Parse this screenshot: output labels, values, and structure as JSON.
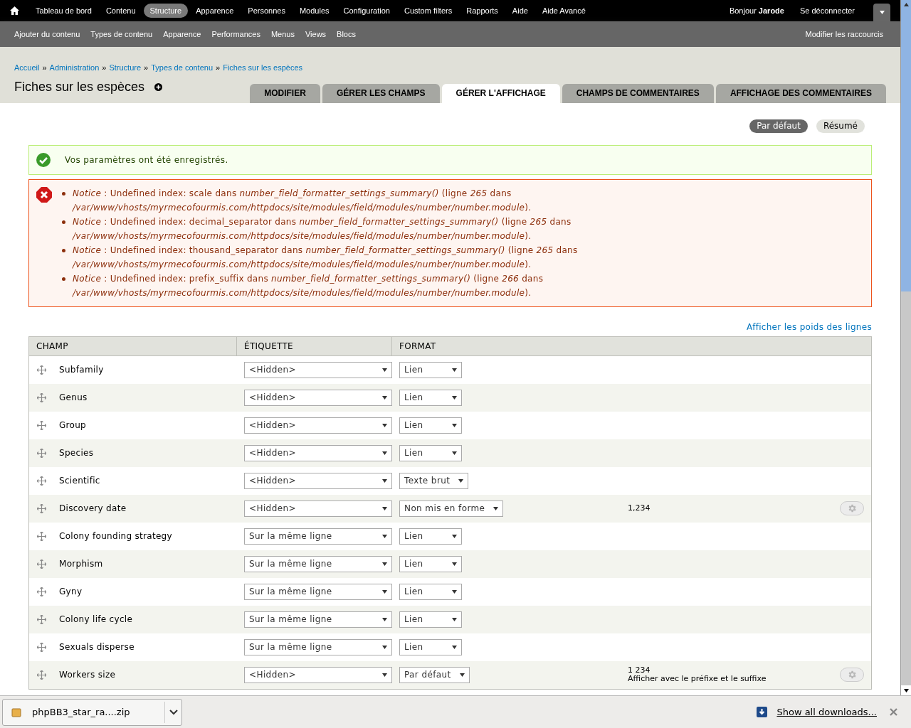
{
  "toolbar": {
    "items": [
      {
        "label": "Tableau de bord",
        "selected": false
      },
      {
        "label": "Contenu",
        "selected": false
      },
      {
        "label": "Structure",
        "selected": true
      },
      {
        "label": "Apparence",
        "selected": false
      },
      {
        "label": "Personnes",
        "selected": false
      },
      {
        "label": "Modules",
        "selected": false
      },
      {
        "label": "Configuration",
        "selected": false
      },
      {
        "label": "Custom filters",
        "selected": false
      },
      {
        "label": "Rapports",
        "selected": false
      },
      {
        "label": "Aide",
        "selected": false
      },
      {
        "label": "Aide Avancé",
        "selected": false
      }
    ],
    "greeting": "Bonjour **Jarode**",
    "logout": "Se déconnecter"
  },
  "shortcuts": {
    "items": [
      "Ajouter du contenu",
      "Types de contenu",
      "Apparence",
      "Performances",
      "Menus",
      "Views",
      "Blocs"
    ],
    "edit": "Modifier les raccourcis"
  },
  "breadcrumb": [
    {
      "label": "Accueil"
    },
    {
      "separator": "»",
      "label": "Administration"
    },
    {
      "separator": "»",
      "label": "Structure"
    },
    {
      "separator": "»",
      "label": "Types de contenu"
    },
    {
      "separator": "»",
      "label": "Fiches sur les espèces"
    }
  ],
  "title": "Fiches sur les espèces",
  "tabs": [
    {
      "label": "MODIFIER",
      "selected": false
    },
    {
      "label": "GÉRER LES CHAMPS",
      "selected": false
    },
    {
      "label": "GÉRER L'AFFICHAGE",
      "selected": true
    },
    {
      "label": "CHAMPS DE COMMENTAIRES",
      "selected": false
    },
    {
      "label": "AFFICHAGE DES COMMENTAIRES",
      "selected": false
    }
  ],
  "subtabs": [
    {
      "label": "Par défaut",
      "selected": true
    },
    {
      "label": "Résumé",
      "selected": false
    }
  ],
  "status_message": "Vos paramètres ont été enregistrés.",
  "error_messages": [
    "*Notice* : Undefined index: scale dans *number_field_formatter_settings_summary()* (ligne *265* dans */var/www/vhosts/myrmecofourmis.com/httpdocs/site/modules/field/modules/number/number.module*).",
    "*Notice* : Undefined index: decimal_separator dans *number_field_formatter_settings_summary()* (ligne *265* dans */var/www/vhosts/myrmecofourmis.com/httpdocs/site/modules/field/modules/number/number.module*).",
    "*Notice* : Undefined index: thousand_separator dans *number_field_formatter_settings_summary()* (ligne *265* dans */var/www/vhosts/myrmecofourmis.com/httpdocs/site/modules/field/modules/number/number.module*).",
    "*Notice* : Undefined index: prefix_suffix dans *number_field_formatter_settings_summary()* (ligne *266* dans */var/www/vhosts/myrmecofourmis.com/httpdocs/site/modules/field/modules/number/number.module*)."
  ],
  "weights_link": "Afficher les poids des lignes",
  "table": {
    "columns": [
      "CHAMP",
      "ÉTIQUETTE",
      "FORMAT"
    ],
    "rows": [
      {
        "name": "Subfamily",
        "label": "<Hidden>",
        "format": "Lien"
      },
      {
        "name": "Genus",
        "label": "<Hidden>",
        "format": "Lien"
      },
      {
        "name": "Group",
        "label": "<Hidden>",
        "format": "Lien"
      },
      {
        "name": "Species",
        "label": "<Hidden>",
        "format": "Lien"
      },
      {
        "name": "Scientific",
        "label": "<Hidden>",
        "format": "Texte brut"
      },
      {
        "name": "Discovery date",
        "label": "<Hidden>",
        "format": "Non mis en forme",
        "summary": [
          "1,234"
        ]
      },
      {
        "name": "Colony founding strategy",
        "label": "Sur la même ligne",
        "format": "Lien"
      },
      {
        "name": "Morphism",
        "label": "Sur la même ligne",
        "format": "Lien"
      },
      {
        "name": "Gyny",
        "label": "Sur la même ligne",
        "format": "Lien"
      },
      {
        "name": "Colony life cycle",
        "label": "Sur la même ligne",
        "format": "Lien"
      },
      {
        "name": "Sexuals disperse",
        "label": "Sur la même ligne",
        "format": "Lien"
      },
      {
        "name": "Workers size",
        "label": "<Hidden>",
        "format": "Par défaut",
        "summary": [
          "1 234",
          "Afficher avec le préfixe et le suffixe"
        ]
      }
    ]
  },
  "downloads": {
    "file": "phpBB3_star_ra....zip",
    "show_all": "Show all downloads..."
  }
}
